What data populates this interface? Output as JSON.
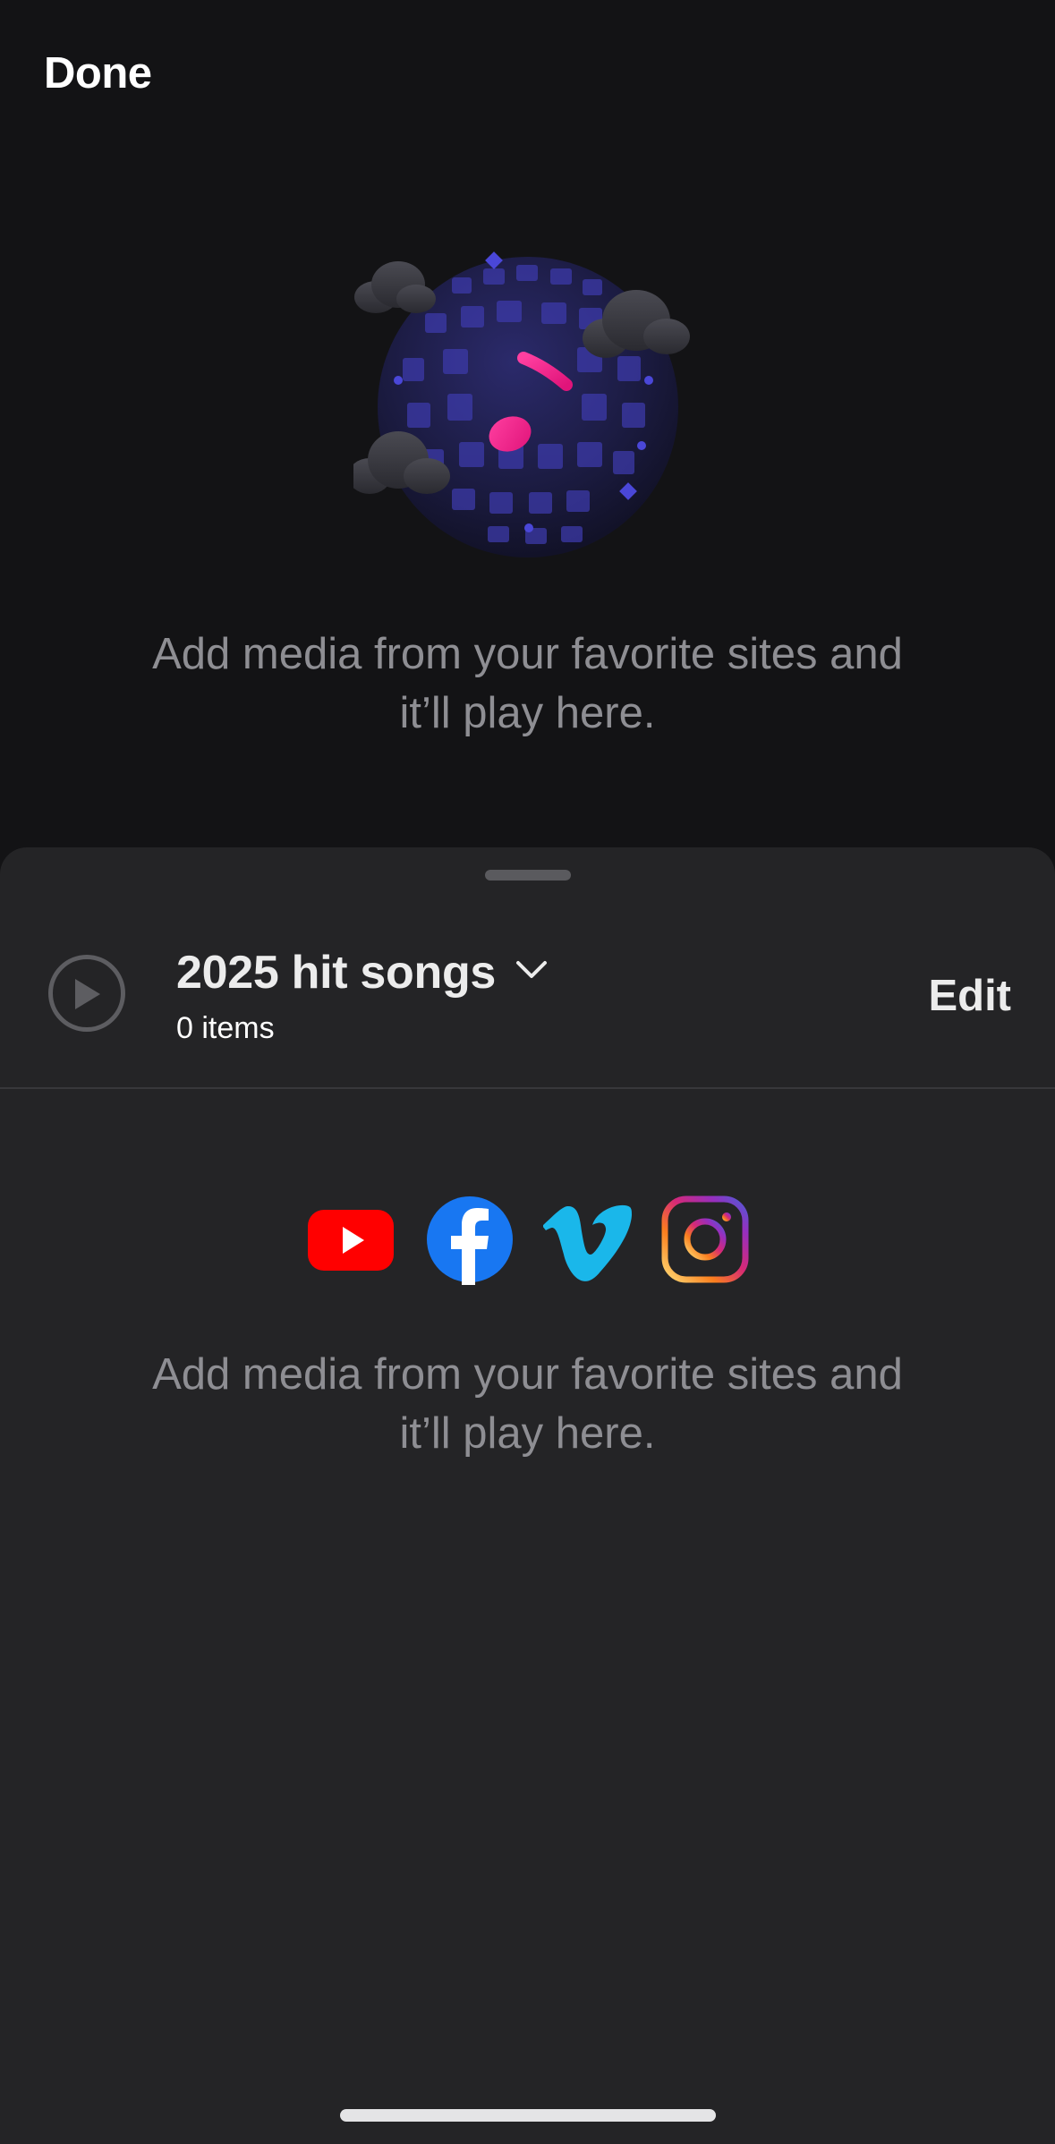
{
  "header": {
    "done_label": "Done"
  },
  "hero": {
    "illustration_icon": "disco-ball-music-note-icon",
    "message_line1": "Add media from your favorite sites and",
    "message_line2": "it’ll play here."
  },
  "sheet": {
    "playlist": {
      "title": "2025 hit songs",
      "count": "0 items",
      "edit_label": "Edit",
      "play_icon": "play-circle-icon",
      "dropdown_icon": "chevron-down-icon"
    },
    "sites": [
      {
        "name": "youtube-icon",
        "color": "#ff0000"
      },
      {
        "name": "facebook-icon",
        "color": "#1877f2"
      },
      {
        "name": "vimeo-icon",
        "color": "#1ab7ea"
      },
      {
        "name": "instagram-icon",
        "color": "#e1306c"
      }
    ],
    "message_line1": "Add media from your favorite sites and",
    "message_line2": "it’ll play here."
  },
  "colors": {
    "background": "#131315",
    "sheet": "#242426",
    "secondary_text": "#8e8e93",
    "accent_pink": "#ff2d8a"
  }
}
